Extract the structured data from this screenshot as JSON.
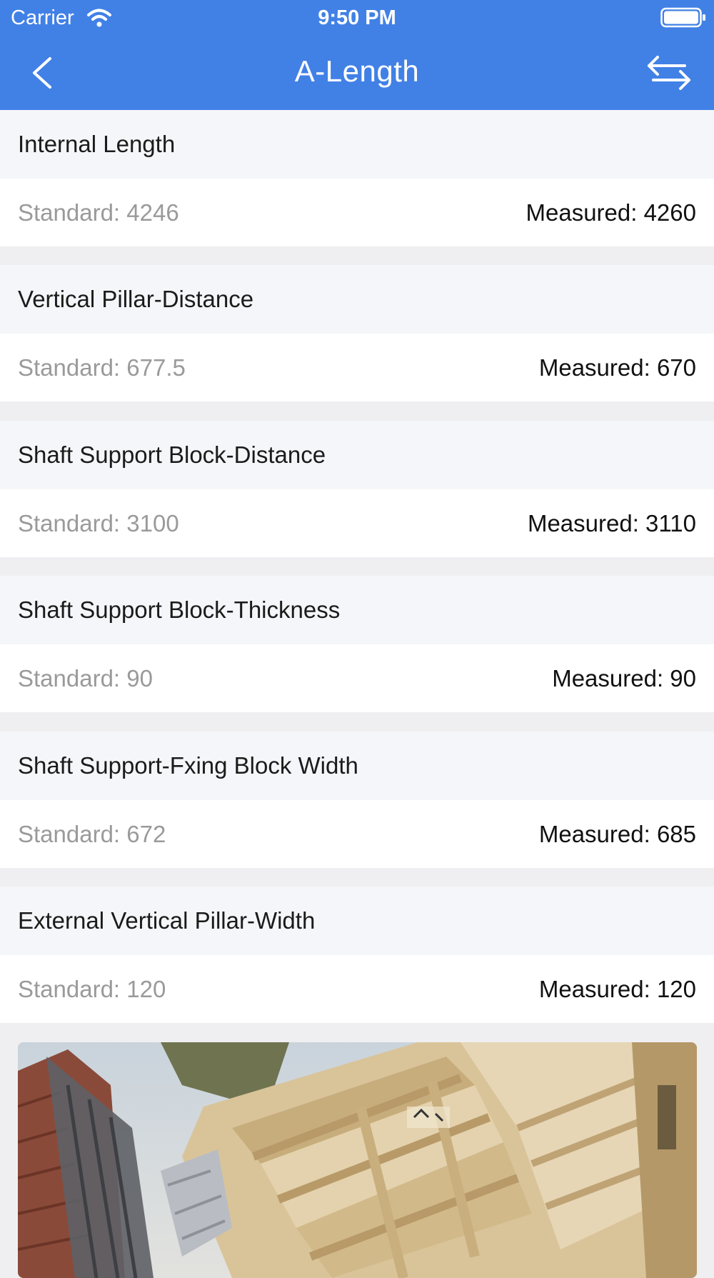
{
  "status": {
    "carrier": "Carrier",
    "time": "9:50 PM"
  },
  "nav": {
    "title": "A-Length",
    "back_icon": "chevron-left-icon",
    "swap_icon": "swap-arrows-icon"
  },
  "sections": [
    {
      "title": "Internal Length",
      "standard": "Standard: 4246",
      "measured": "Measured: 4260"
    },
    {
      "title": "Vertical Pillar-Distance",
      "standard": "Standard: 677.5",
      "measured": "Measured: 670"
    },
    {
      "title": "Shaft Support Block-Distance",
      "standard": "Standard: 3100",
      "measured": "Measured: 3110"
    },
    {
      "title": "Shaft Support Block-Thickness",
      "standard": "Standard: 90",
      "measured": "Measured: 90"
    },
    {
      "title": "Shaft Support-Fxing Block Width",
      "standard": "Standard: 672",
      "measured": "Measured: 685"
    },
    {
      "title": "External Vertical Pillar-Width",
      "standard": "Standard: 120",
      "measured": "Measured: 120"
    }
  ],
  "colors": {
    "accent": "#4181e6",
    "header_bg": "#f5f6f9",
    "separator": "#efeff1"
  }
}
